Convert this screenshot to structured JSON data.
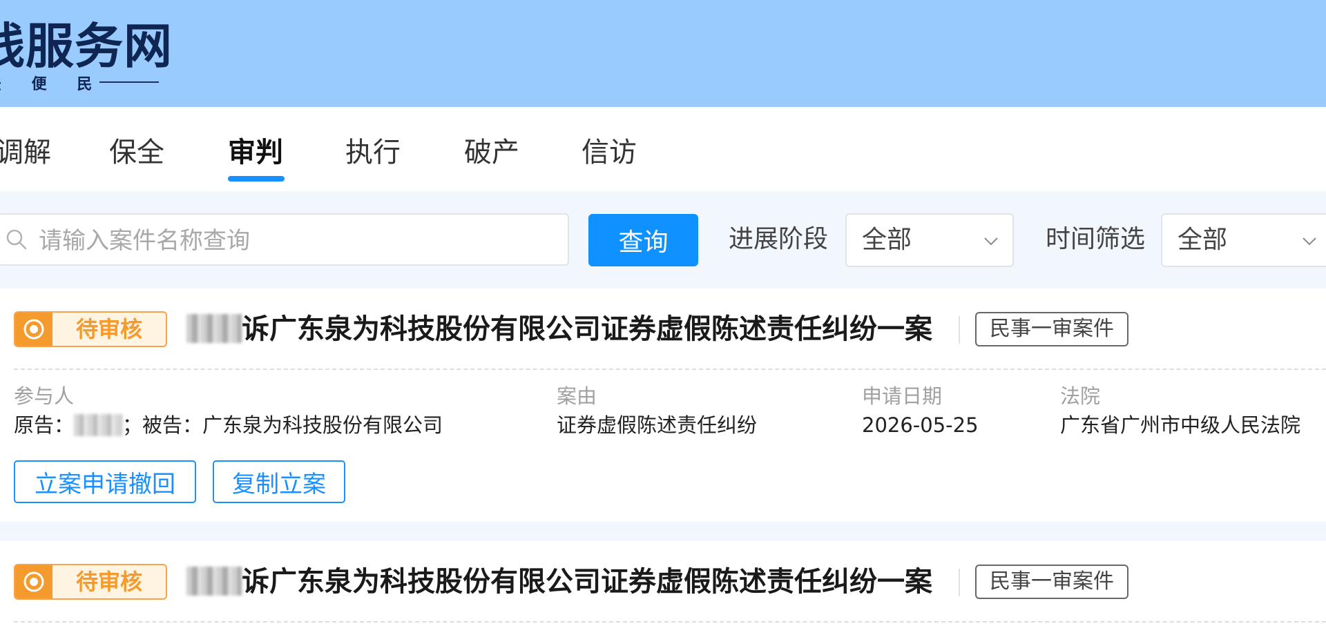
{
  "header": {
    "site_title": "线服务网",
    "slogan": "法 便 民"
  },
  "nav_tabs": [
    {
      "label": "调解"
    },
    {
      "label": "保全"
    },
    {
      "label": "审判",
      "active": true
    },
    {
      "label": "执行"
    },
    {
      "label": "破产"
    },
    {
      "label": "信访"
    }
  ],
  "search": {
    "placeholder": "请输入案件名称查询",
    "query_button": "查询"
  },
  "filters": {
    "progress_label": "进展阶段",
    "progress_value": "全部",
    "time_label": "时间筛选",
    "time_value": "全部"
  },
  "cases": [
    {
      "status": "待审核",
      "title": "诉广东泉为科技股份有限公司证券虚假陈述责任纠纷一案",
      "case_type": "民事一审案件",
      "participants_label": "参与人",
      "plaintiff_prefix": "原告：",
      "defendant_text": "；被告：广东泉为科技股份有限公司",
      "cause_label": "案由",
      "cause_value": "证券虚假陈述责任纠纷",
      "date_label": "申请日期",
      "date_value": "2026-05-25",
      "court_label": "法院",
      "court_value": "广东省广州市中级人民法院",
      "actions": [
        "立案申请撤回",
        "复制立案"
      ]
    },
    {
      "status": "待审核",
      "title": "诉广东泉为科技股份有限公司证券虚假陈述责任纠纷一案",
      "case_type": "民事一审案件"
    }
  ],
  "colors": {
    "header_bg": "#99cbff",
    "accent_blue": "#1890ff",
    "status_orange": "#f59a2c"
  },
  "icons": [
    "search-icon",
    "chevron-down-icon",
    "pending-status-icon"
  ]
}
